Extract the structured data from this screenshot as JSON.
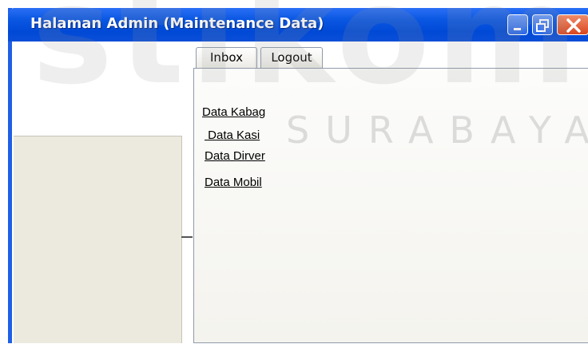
{
  "window": {
    "title": "Halaman Admin (Maintenance Data)",
    "controls": {
      "minimize": "minimize-icon",
      "maximize": "restore-icon",
      "close": "close-icon"
    }
  },
  "tabs": [
    {
      "label": "Inbox"
    },
    {
      "label": "Logout"
    }
  ],
  "links": [
    {
      "label": "Data Kabag"
    },
    {
      "label": " Data Kasi"
    },
    {
      "label": "Data Dirver"
    },
    {
      "label": "Data Mobil"
    }
  ],
  "watermark": {
    "large": "stikom",
    "small": "SURABAYA"
  },
  "colors": {
    "titlebar": "#0a57e2",
    "close_button": "#d9461e",
    "panel_bg": "#ece9df"
  }
}
